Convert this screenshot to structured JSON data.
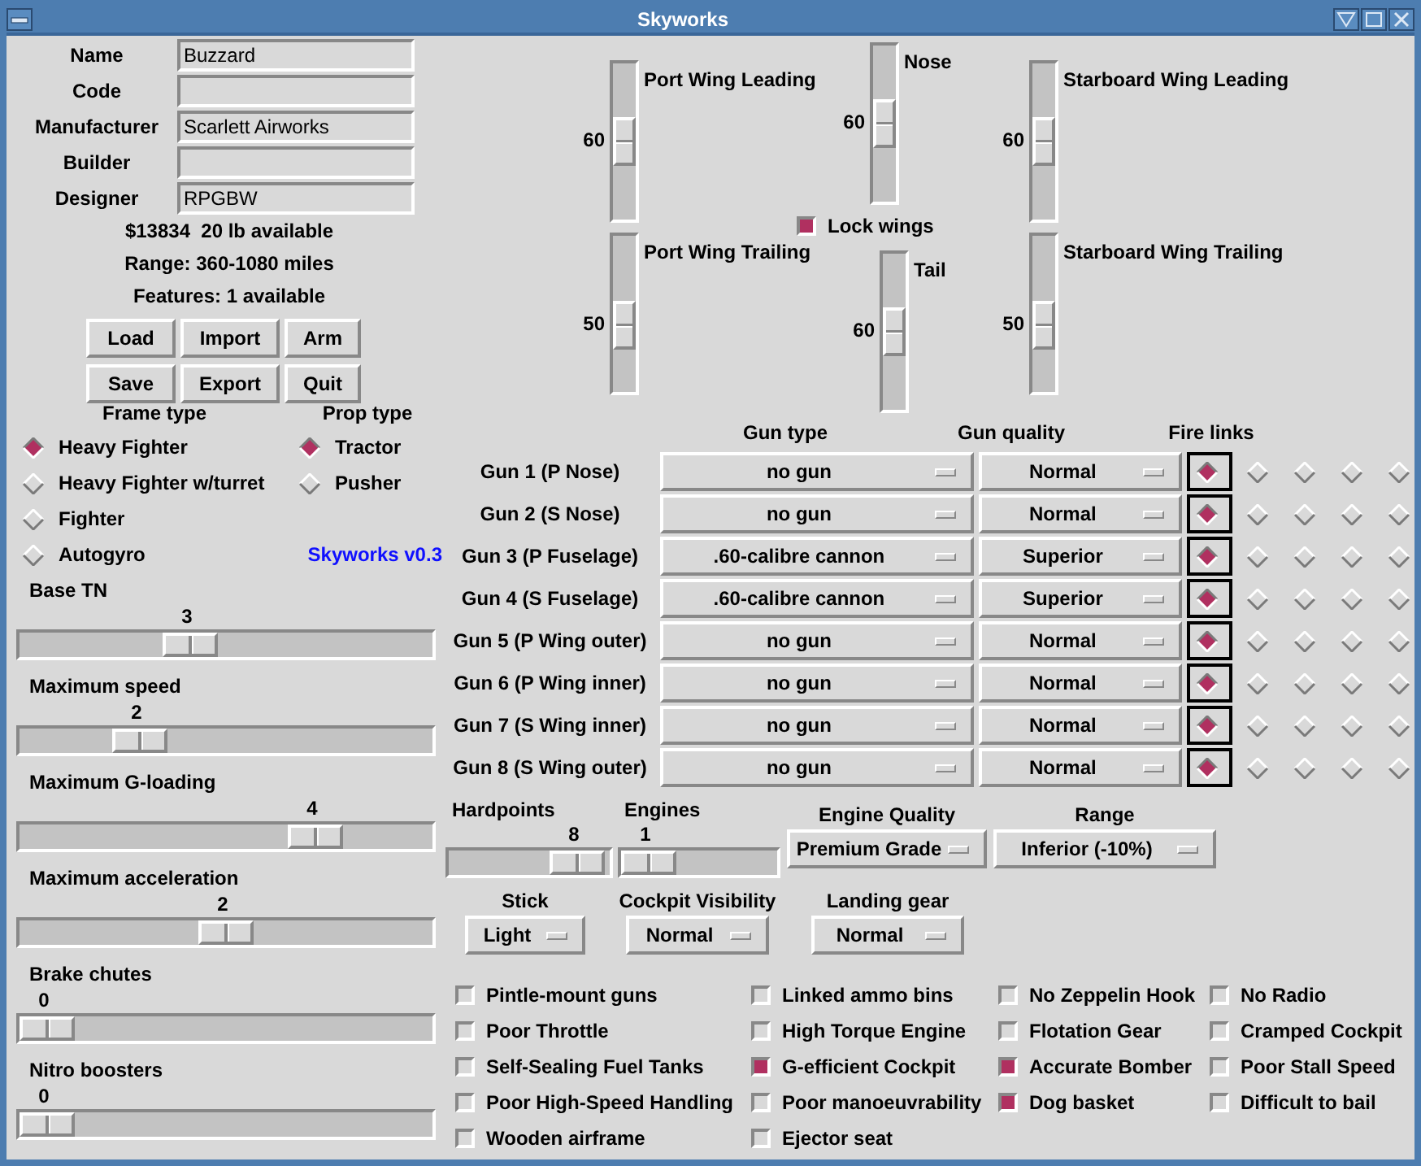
{
  "window": {
    "title": "Skyworks"
  },
  "info_fields": [
    {
      "label": "Name",
      "value": "Buzzard"
    },
    {
      "label": "Code"
    },
    {
      "label": "Manufacturer",
      "value": "Scarlett Airworks"
    },
    {
      "label": "Builder"
    },
    {
      "label": "Designer",
      "value": "RPGBW"
    }
  ],
  "summary_lines": [
    "$13834  20 lb available",
    "Range: 360-1080 miles",
    "Features: 1 available"
  ],
  "buttons": [
    "Load",
    "Import",
    "Arm",
    "Save",
    "Export",
    "Quit"
  ],
  "frame_type": {
    "label": "Frame type",
    "options": [
      {
        "label": "Heavy Fighter",
        "selected": true
      },
      {
        "label": "Heavy Fighter w/turret",
        "selected": false
      },
      {
        "label": "Fighter",
        "selected": false
      },
      {
        "label": "Autogyro",
        "selected": false
      }
    ]
  },
  "prop_type": {
    "label": "Prop type",
    "options": [
      {
        "label": "Tractor",
        "selected": true
      },
      {
        "label": "Pusher",
        "selected": false
      }
    ]
  },
  "version": "Skyworks v0.3",
  "sliders": [
    {
      "label": "Base TN",
      "reading": "3",
      "level": 0.4
    },
    {
      "label": "Maximum speed",
      "reading": "2",
      "level": 0.26
    },
    {
      "label": "Maximum G-loading",
      "reading": "4",
      "level": 0.75
    },
    {
      "label": "Maximum acceleration",
      "reading": "2",
      "level": 0.5
    },
    {
      "label": "Brake chutes",
      "reading": "0",
      "level": 0
    },
    {
      "label": "Nitro boosters",
      "reading": "0",
      "level": 0
    }
  ],
  "control_surfaces": [
    {
      "label": "Port Wing Leading",
      "reading": "60",
      "level": 0.5
    },
    {
      "label": "Nose",
      "reading": "60",
      "level": 0.5
    },
    {
      "label": "Starboard Wing Leading",
      "reading": "60",
      "level": 0.5
    },
    {
      "label": "Port Wing Trailing",
      "reading": "50",
      "level": 0.6
    },
    {
      "label": "Tail",
      "reading": "60",
      "level": 0.5
    },
    {
      "label": "Starboard Wing Trailing",
      "reading": "50",
      "level": 0.6
    }
  ],
  "lock_wings": {
    "label": "Lock wings",
    "checked": true
  },
  "guns": {
    "columns": [
      "Gun type",
      "Gun quality",
      "Fire links"
    ],
    "rows": [
      {
        "label": "Gun 1 (P Nose)",
        "type": "no gun",
        "quality": "Normal",
        "fire_links": [
          {
            "selected": true
          },
          {
            "selected": false
          },
          {
            "selected": false
          },
          {
            "selected": false
          },
          {
            "selected": false
          }
        ]
      },
      {
        "label": "Gun 2 (S Nose)",
        "type": "no gun",
        "quality": "Normal",
        "fire_links": [
          {
            "selected": true
          },
          {
            "selected": false
          },
          {
            "selected": false
          },
          {
            "selected": false
          },
          {
            "selected": false
          }
        ]
      },
      {
        "label": "Gun 3 (P Fuselage)",
        "type": ".60-calibre cannon",
        "quality": "Superior",
        "fire_links": [
          {
            "selected": true
          },
          {
            "selected": false
          },
          {
            "selected": false
          },
          {
            "selected": false
          },
          {
            "selected": false
          }
        ]
      },
      {
        "label": "Gun 4 (S Fuselage)",
        "type": ".60-calibre cannon",
        "quality": "Superior",
        "fire_links": [
          {
            "selected": true
          },
          {
            "selected": false
          },
          {
            "selected": false
          },
          {
            "selected": false
          },
          {
            "selected": false
          }
        ]
      },
      {
        "label": "Gun 5 (P Wing outer)",
        "type": "no gun",
        "quality": "Normal",
        "fire_links": [
          {
            "selected": true
          },
          {
            "selected": false
          },
          {
            "selected": false
          },
          {
            "selected": false
          },
          {
            "selected": false
          }
        ]
      },
      {
        "label": "Gun 6 (P Wing inner)",
        "type": "no gun",
        "quality": "Normal",
        "fire_links": [
          {
            "selected": true
          },
          {
            "selected": false
          },
          {
            "selected": false
          },
          {
            "selected": false
          },
          {
            "selected": false
          }
        ]
      },
      {
        "label": "Gun 7 (S Wing inner)",
        "type": "no gun",
        "quality": "Normal",
        "fire_links": [
          {
            "selected": true
          },
          {
            "selected": false
          },
          {
            "selected": false
          },
          {
            "selected": false
          },
          {
            "selected": false
          }
        ]
      },
      {
        "label": "Gun 8 (S Wing outer)",
        "type": "no gun",
        "quality": "Normal",
        "fire_links": [
          {
            "selected": true
          },
          {
            "selected": false
          },
          {
            "selected": false
          },
          {
            "selected": false
          },
          {
            "selected": false
          }
        ]
      }
    ]
  },
  "hardpoints": {
    "label": "Hardpoints",
    "reading": "8",
    "level": 0.95
  },
  "engines": {
    "label": "Engines",
    "reading": "1",
    "level": 0
  },
  "dropdowns": [
    {
      "label": "Engine Quality",
      "value": "Premium Grade"
    },
    {
      "label": "Range",
      "value": "Inferior (-10%)"
    },
    {
      "label": "Stick",
      "value": "Light"
    },
    {
      "label": "Cockpit Visibility",
      "value": "Normal"
    },
    {
      "label": "Landing gear",
      "value": "Normal"
    }
  ],
  "option_columns": [
    {
      "items": [
        {
          "label": "Pintle-mount guns",
          "checked": false
        },
        {
          "label": "Poor Throttle",
          "checked": false
        },
        {
          "label": "Self-Sealing Fuel Tanks",
          "checked": false
        },
        {
          "label": "Poor High-Speed Handling",
          "checked": false
        },
        {
          "label": "Wooden airframe",
          "checked": false
        }
      ]
    },
    {
      "items": [
        {
          "label": "Linked ammo bins",
          "checked": false
        },
        {
          "label": "High Torque Engine",
          "checked": false
        },
        {
          "label": "G-efficient Cockpit",
          "checked": true
        },
        {
          "label": "Poor manoeuvrability",
          "checked": false
        },
        {
          "label": "Ejector seat",
          "checked": false
        }
      ]
    },
    {
      "items": [
        {
          "label": "No Zeppelin Hook",
          "checked": false
        },
        {
          "label": "Flotation Gear",
          "checked": false
        },
        {
          "label": "Accurate Bomber",
          "checked": true
        },
        {
          "label": "Dog basket",
          "checked": true
        }
      ]
    },
    {
      "items": [
        {
          "label": "No Radio",
          "checked": false
        },
        {
          "label": "Cramped Cockpit",
          "checked": false
        },
        {
          "label": "Poor Stall Speed",
          "checked": false
        },
        {
          "label": "Difficult to bail",
          "checked": false
        }
      ]
    }
  ]
}
